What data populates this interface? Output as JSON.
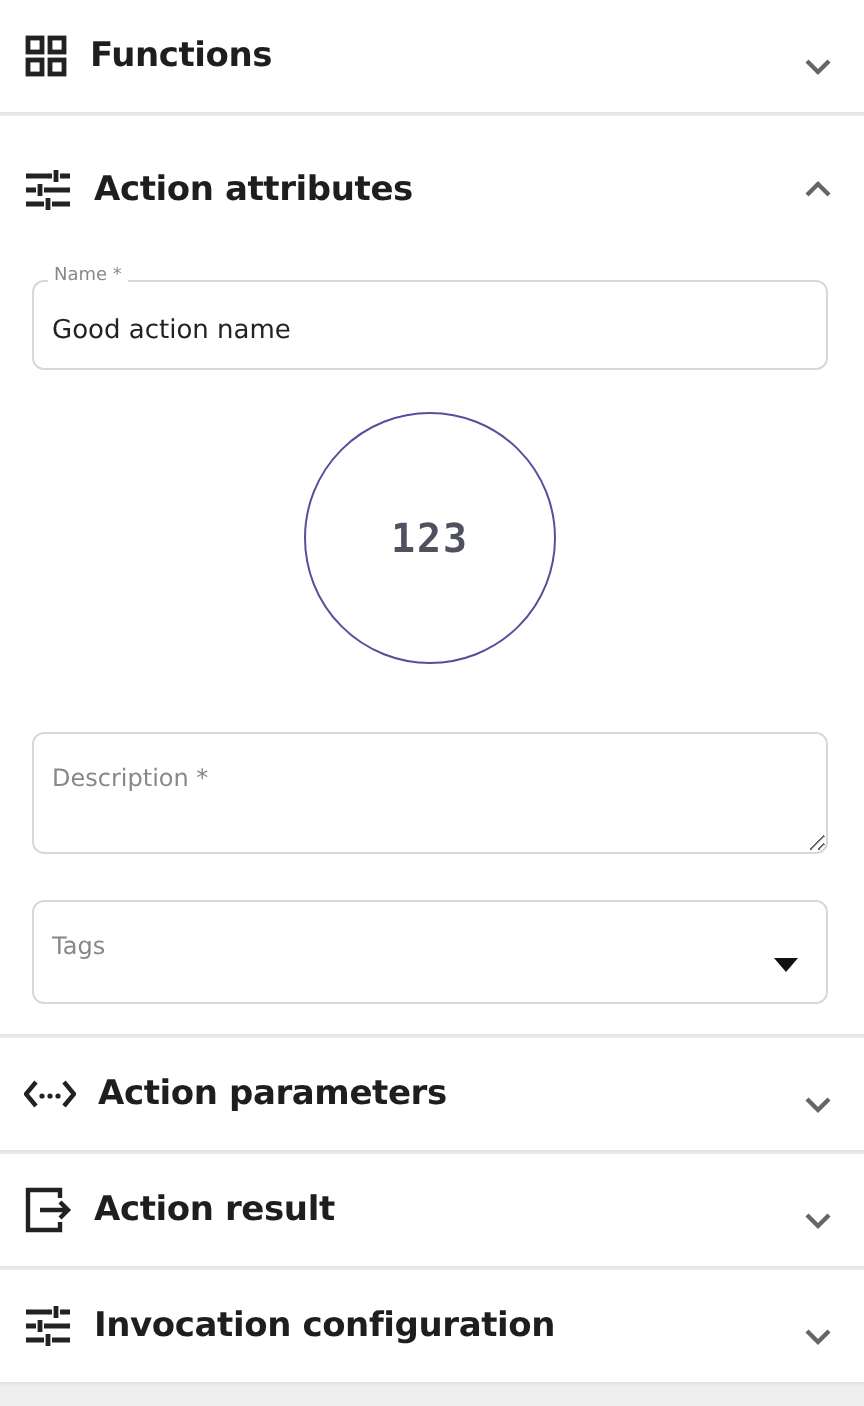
{
  "sections": [
    {
      "title": "Functions",
      "expanded": false
    },
    {
      "title": "Action attributes",
      "expanded": true,
      "form": {
        "name_field": {
          "label": "Name *",
          "value": "Good action name"
        },
        "avatar": {
          "text": "123"
        },
        "description_field": {
          "placeholder": "Description *"
        },
        "tags_field": {
          "placeholder": "Tags"
        }
      }
    },
    {
      "title": "Action parameters",
      "expanded": false
    },
    {
      "title": "Action result",
      "expanded": false
    },
    {
      "title": "Invocation configuration",
      "expanded": false
    }
  ]
}
